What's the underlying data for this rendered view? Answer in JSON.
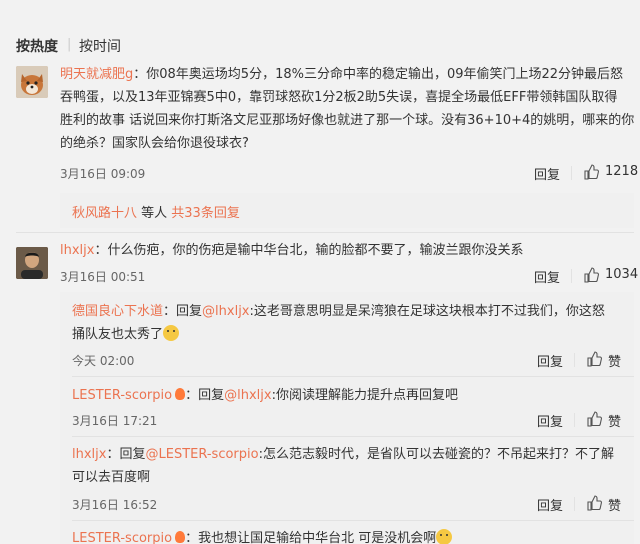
{
  "sort": {
    "hot": "按热度",
    "sep": "|",
    "time": "按时间"
  },
  "reply_label": "回复",
  "like_label": "赞",
  "comments": [
    {
      "user": "明天就减肥g",
      "text_lines": [
        "：你08年奥运场均5分，18%三分命中率的稳定输出，09年偷笑门上场22分钟最后怒",
        "吞鸭蛋，以及13年亚锦赛5中0，靠罚球怒砍1分2板2助5失误，喜提全场最低EFF带领韩国队取得",
        "胜利的故事 话说回来你打斯洛文尼亚那场好像也就进了那一个球。没有36+10+4的姚明，哪来的你",
        "的绝杀？国家队会给你退役球衣?"
      ],
      "time": "3月16日 09:09",
      "likes": "1218",
      "summary_user": "秋风路十八",
      "summary_mid": " 等人 ",
      "summary_more": "共33条回复"
    },
    {
      "user": "lhxljx",
      "text": "：什么伤疤，你的伤疤是输中华台北，输的脸都不要了，输波兰跟你没关系",
      "time": "3月16日 00:51",
      "likes": "1034"
    }
  ],
  "replies": [
    {
      "user": "德国良心下水道",
      "prefix": "：回复",
      "mention": "@lhxljx",
      "line1": ":这老哥意思明显是呆湾狼在足球这块根本打不过我们，你这怒",
      "line2": "捅队友也太秀了",
      "time": "今天 02:00",
      "like": "赞"
    },
    {
      "user": "LESTER-scorpio",
      "prefix": "：回复",
      "mention": "@lhxljx",
      "line1": ":你阅读理解能力提升点再回复吧",
      "time": "3月16日 17:21",
      "like": "赞"
    },
    {
      "user": "lhxljx",
      "prefix": "：回复",
      "mention": "@LESTER-scorpio",
      "line1": ":怎么范志毅时代，是省队可以去碰瓷的？不吊起来打？不了解",
      "line2": "可以去百度啊",
      "time": "3月16日 16:52",
      "like": "赞"
    },
    {
      "user": "LESTER-scorpio",
      "prefix": "：",
      "line1": "我也想让国足输给中华台北 可是没机会啊"
    }
  ]
}
